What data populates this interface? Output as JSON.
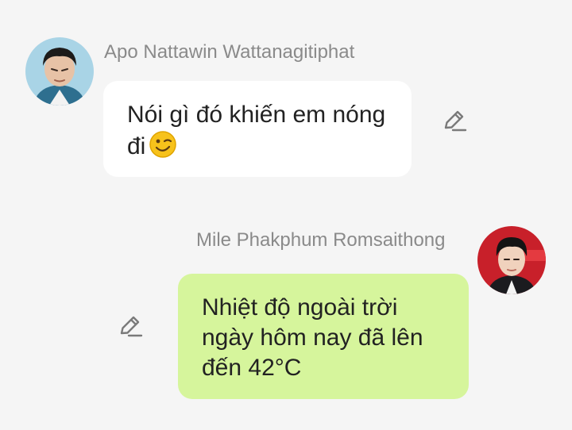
{
  "messages": [
    {
      "sender": "Apo Nattawin Wattanagitiphat",
      "text": "Nói gì đó khiến em nóng đi",
      "emoji": "winking-face-emoji",
      "direction": "incoming",
      "bubble_color": "#ffffff",
      "edit_icon": "pencil-icon"
    },
    {
      "sender": "Mile Phakphum Romsaithong",
      "text": "Nhiệt độ ngoài trời ngày hôm nay đã lên đến 42°C",
      "direction": "outgoing",
      "bubble_color": "#d6f59c",
      "edit_icon": "pencil-icon"
    }
  ]
}
